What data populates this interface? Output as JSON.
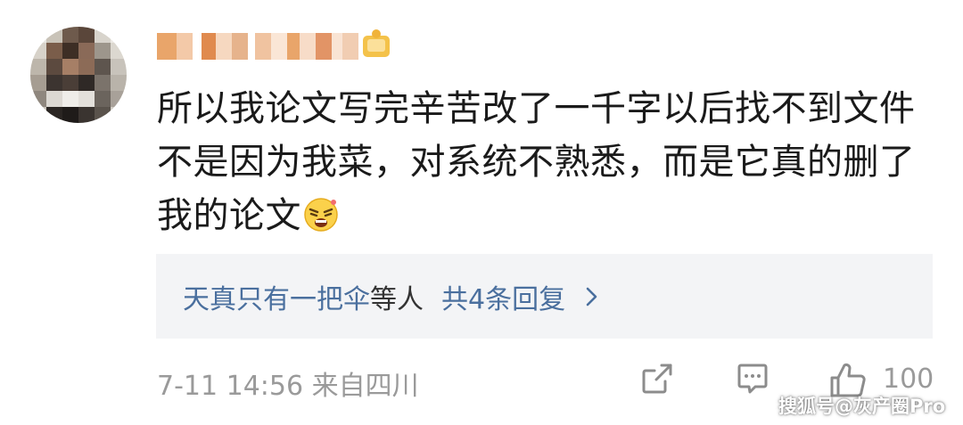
{
  "post": {
    "comment_text": "所以我论文写完辛苦改了一千字以后找不到文件不是因为我菜，对系统不熟悉，而是它真的删了我的论文",
    "emoji_icon": "angry-face-emoji"
  },
  "replies": {
    "who": "天真只有一把伞",
    "etc": "等人",
    "count": "共4条回复",
    "chevron_icon": "chevron-right-icon"
  },
  "footer": {
    "time_location": "7-11 14:56 来自四川",
    "share_icon": "share-icon",
    "comment_icon": "comment-icon",
    "like_icon": "thumbs-up-icon",
    "like_count": "100"
  },
  "watermark": {
    "text": "搜狐号@灰产圈Pro"
  },
  "colors": {
    "link_blue": "#4a6f9e",
    "muted_gray": "#9a9a9a",
    "reply_bg": "#f3f4f6"
  }
}
